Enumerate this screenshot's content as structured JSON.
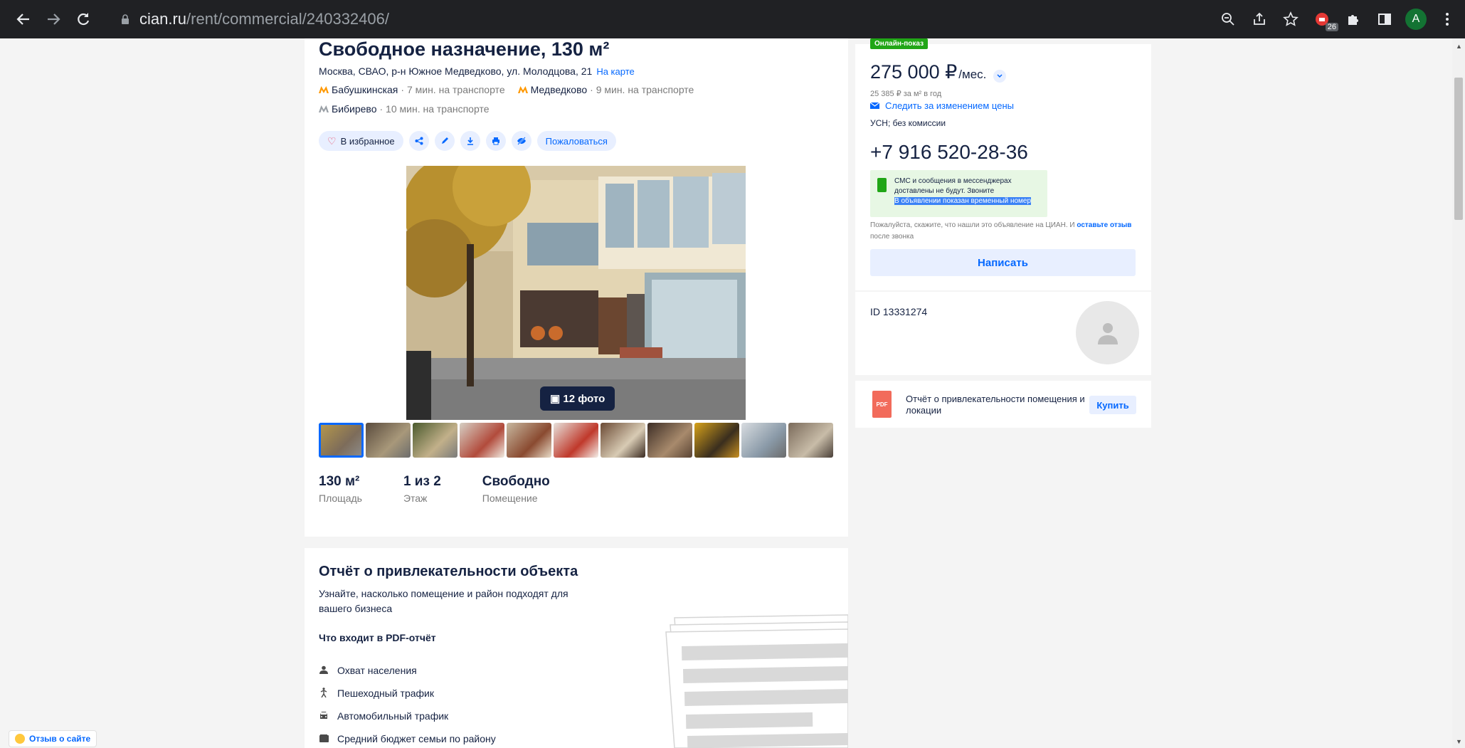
{
  "browser": {
    "url_host": "cian.ru",
    "url_path": "/rent/commercial/240332406/",
    "extension_badge": "26",
    "profile_initial": "A"
  },
  "listing": {
    "title": "Свободное назначение, 130 м²",
    "address": "Москва, СВАО, р-н Южное Медведково, ул. Молодцова, 21",
    "map_link": "На карте",
    "metro": [
      {
        "name": "Бабушкинская",
        "time": "· 7 мин. на транспорте",
        "color": "#ff9800"
      },
      {
        "name": "Медведково",
        "time": "· 9 мин. на транспорте",
        "color": "#ff9800"
      },
      {
        "name": "Бибирево",
        "time": "· 10 мин. на транспорте",
        "color": "#9aa0a6"
      }
    ],
    "favorite_label": "В избранное",
    "complain_label": "Пожаловаться",
    "photo_count": "12 фото",
    "facts": [
      {
        "value": "130 м²",
        "label": "Площадь"
      },
      {
        "value": "1 из 2",
        "label": "Этаж"
      },
      {
        "value": "Свободно",
        "label": "Помещение"
      }
    ]
  },
  "report": {
    "title": "Отчёт о привлекательности объекта",
    "description": "Узнайте, насколько помещение и район подходят для вашего бизнеса",
    "subtitle": "Что входит в PDF-отчёт",
    "items": [
      {
        "icon": "person-icon",
        "label": "Охват населения"
      },
      {
        "icon": "walking-icon",
        "label": "Пешеходный трафик"
      },
      {
        "icon": "car-icon",
        "label": "Автомобильный трафик"
      },
      {
        "icon": "wallet-icon",
        "label": "Средний бюджет семьи по району"
      }
    ]
  },
  "sidebar": {
    "online_badge": "Онлайн-показ",
    "price": "275 000 ₽",
    "price_period": "/мес.",
    "price_per_m2": "25 385 ₽ за м² в год",
    "track_price": "Следить за изменением цены",
    "tax": "УСН; без комиссии",
    "phone": "+7 916 520-28-36",
    "sms_line1": "СМС и сообщения в мессенджерах доставлены не будут. Звоните",
    "sms_line2": "В объявлении показан временный номер",
    "feedback_text": "Пожалуйста, скажите, что нашли это объявление на ЦИАН. И",
    "feedback_link": "оставьте отзыв",
    "feedback_tail": "после звонка",
    "write_button": "Написать",
    "agent_id": "ID 13331274",
    "report_card_text": "Отчёт о привлекательности помещения и локации",
    "buy_button": "Купить"
  },
  "site_feedback": "Отзыв о сайте",
  "colors": {
    "accent": "#0468ff",
    "text": "#152242",
    "online": "#20a616"
  }
}
